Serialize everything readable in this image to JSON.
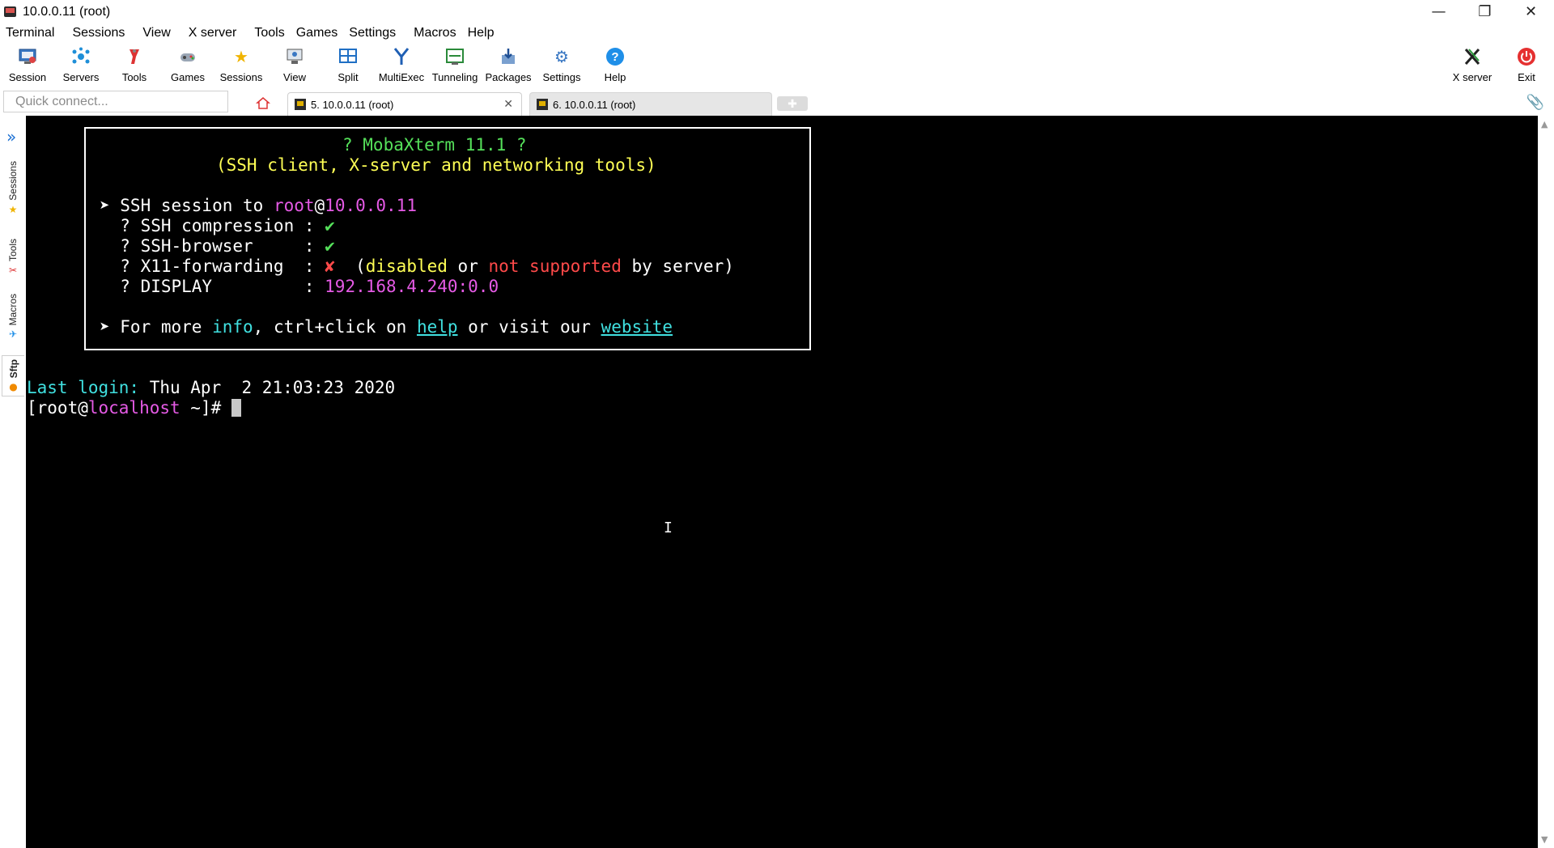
{
  "window": {
    "title": "10.0.0.11 (root)",
    "controls": {
      "minimize": "—",
      "restore": "❐",
      "close": "✕"
    }
  },
  "menubar": [
    "Terminal",
    "Sessions",
    "View",
    "X server",
    "Tools",
    "Games",
    "Settings",
    "Macros",
    "Help"
  ],
  "toolbar": {
    "items": [
      {
        "label": "Session",
        "icon": "session-icon"
      },
      {
        "label": "Servers",
        "icon": "servers-icon"
      },
      {
        "label": "Tools",
        "icon": "tools-icon"
      },
      {
        "label": "Games",
        "icon": "games-icon"
      },
      {
        "label": "Sessions",
        "icon": "star-icon"
      },
      {
        "label": "View",
        "icon": "view-icon"
      },
      {
        "label": "Split",
        "icon": "split-icon"
      },
      {
        "label": "MultiExec",
        "icon": "multiexec-icon"
      },
      {
        "label": "Tunneling",
        "icon": "tunneling-icon"
      },
      {
        "label": "Packages",
        "icon": "packages-icon"
      },
      {
        "label": "Settings",
        "icon": "settings-icon"
      },
      {
        "label": "Help",
        "icon": "help-icon"
      }
    ],
    "right_items": [
      {
        "label": "X server",
        "icon": "xserver-icon"
      },
      {
        "label": "Exit",
        "icon": "power-icon"
      }
    ]
  },
  "quick_connect": {
    "placeholder": "Quick connect..."
  },
  "tabs": [
    {
      "label": "5. 10.0.0.11 (root)",
      "active": true
    },
    {
      "label": "6. 10.0.0.11 (root)",
      "active": false
    }
  ],
  "side_tabs": [
    "Sessions",
    "Tools",
    "Macros",
    "Sftp"
  ],
  "terminal": {
    "banner_title": "? MobaXterm 11.1 ?",
    "banner_subtitle": "(SSH client, X-server and networking tools)",
    "ssh_session_prefix": "➤ SSH session to ",
    "ssh_user": "root",
    "ssh_at": "@",
    "ssh_host": "10.0.0.11",
    "compression_label": "  ? SSH compression : ",
    "compression_value": "✔",
    "browser_label": "  ? SSH-browser     : ",
    "browser_value": "✔",
    "x11_label": "  ? X11-forwarding  : ",
    "x11_value": "✘",
    "x11_note_open": "  (",
    "x11_disabled": "disabled",
    "x11_or": " or ",
    "x11_not_supported": "not supported",
    "x11_by_server": " by server)",
    "display_label": "  ? DISPLAY         : ",
    "display_value": "192.168.4.240:0.0",
    "info_prefix": "➤ For more ",
    "info_word": "info",
    "info_mid": ", ctrl+click on ",
    "help_word": "help",
    "info_mid2": " or visit our ",
    "website_word": "website",
    "last_login_label": "Last login:",
    "last_login_value": " Thu Apr  2 21:03:23 2020",
    "prompt_open": "[root@",
    "prompt_host": "localhost",
    "prompt_close": " ~]# "
  },
  "colors": {
    "terminal_bg": "#000000",
    "green": "#55e05a",
    "yellow": "#ffff55",
    "magenta": "#e55ae5",
    "red": "#ff4a4a",
    "cyan": "#40e0e0"
  }
}
